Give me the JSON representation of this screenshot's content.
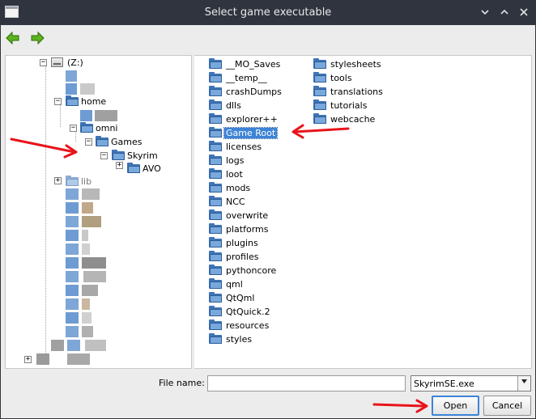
{
  "window": {
    "title": "Select game executable",
    "controls": [
      "chevron-down",
      "chevron-up",
      "close"
    ]
  },
  "toolbar": {
    "back_icon": "back-arrow-icon",
    "forward_icon": "forward-arrow-icon"
  },
  "tree": {
    "drive_label": "(Z:)",
    "home": "home",
    "omni": "omni",
    "games": "Games",
    "skyrim": "Skyrim",
    "avo": "AVO",
    "lib": "lib"
  },
  "files": {
    "column1": [
      "__MO_Saves",
      "__temp__",
      "crashDumps",
      "dlls",
      "explorer++",
      "Game Root",
      "licenses",
      "logs",
      "loot",
      "mods",
      "NCC",
      "overwrite",
      "platforms",
      "plugins",
      "profiles",
      "pythoncore",
      "qml",
      "QtQml",
      "QtQuick.2",
      "resources",
      "styles"
    ],
    "column2": [
      "stylesheets",
      "tools",
      "translations",
      "tutorials",
      "webcache"
    ],
    "selected": "Game Root"
  },
  "footer": {
    "filename_label": "File name:",
    "filename_value": "",
    "filetype": "SkyrimSE.exe",
    "open_label": "Open",
    "cancel_label": "Cancel"
  },
  "colors": {
    "titlebar": "#2f343f",
    "folder": "#79a8dc",
    "selection": "#3d84d6",
    "annotation_arrow": "#e8141b"
  }
}
